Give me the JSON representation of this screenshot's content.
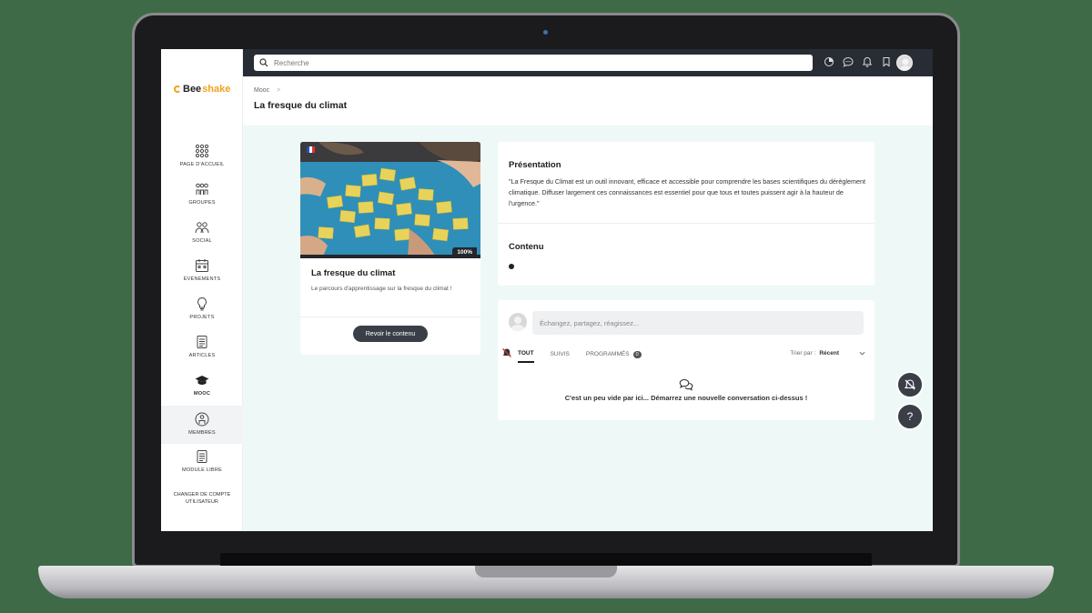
{
  "app": {
    "logo_text_a": "Bee",
    "logo_text_b": "shake"
  },
  "search": {
    "placeholder": "Recherche"
  },
  "topbar_icons": [
    "stats-icon",
    "chat-icon",
    "bell-icon",
    "bookmark-icon"
  ],
  "sidebar": {
    "items": [
      {
        "label": "PAGE D'ACCUEIL",
        "icon": "grid-icon"
      },
      {
        "label": "GROUPES",
        "icon": "groups-icon"
      },
      {
        "label": "SOCIAL",
        "icon": "social-icon"
      },
      {
        "label": "ÉVÉNEMENTS",
        "icon": "calendar-icon"
      },
      {
        "label": "PROJETS",
        "icon": "lightbulb-icon"
      },
      {
        "label": "ARTICLES",
        "icon": "document-icon"
      },
      {
        "label": "MOOC",
        "icon": "graduation-cap-icon",
        "active": true
      },
      {
        "label": "MEMBRES",
        "icon": "member-icon"
      },
      {
        "label": "MODULE LIBRE",
        "icon": "document-icon"
      }
    ],
    "switch_account": "CHANGER DE COMPTE UTILISATEUR"
  },
  "header": {
    "breadcrumb": "Mooc",
    "breadcrumb_sep": ">",
    "title": "La fresque du climat"
  },
  "course": {
    "progress_label": "100%",
    "progress": 1.0,
    "title": "La fresque du climat",
    "description": "Le parcours d'apprentissage sur la fresque du climat !",
    "review_button": "Revoir le contenu"
  },
  "presentation": {
    "title": "Présentation",
    "text": "\"La Fresque du Climat est un outil innovant, efficace et accessible pour comprendre les bases scientifiques du dérèglement climatique. Diffuser largement ces connaissances est essentiel pour que tous et toutes puissent agir à la hauteur de l'urgence.\"",
    "content_title": "Contenu"
  },
  "discussion": {
    "input_placeholder": "Échangez, partagez, réagissez...",
    "tabs": [
      {
        "label": "TOUT",
        "active": true
      },
      {
        "label": "SUIVIS"
      },
      {
        "label": "PROGRAMMÉS",
        "badge": "0"
      }
    ],
    "sort_label": "Trier par :",
    "sort_value": "Récent",
    "empty_text": "C'est un peu vide par ici... Démarrez une nouvelle conversation ci-dessus !"
  },
  "fab": {
    "help_label": "?"
  },
  "colors": {
    "accent": "#f0a21e",
    "topbar": "#282c34",
    "button": "#3a3f47",
    "page_bg": "#eef8f7"
  }
}
